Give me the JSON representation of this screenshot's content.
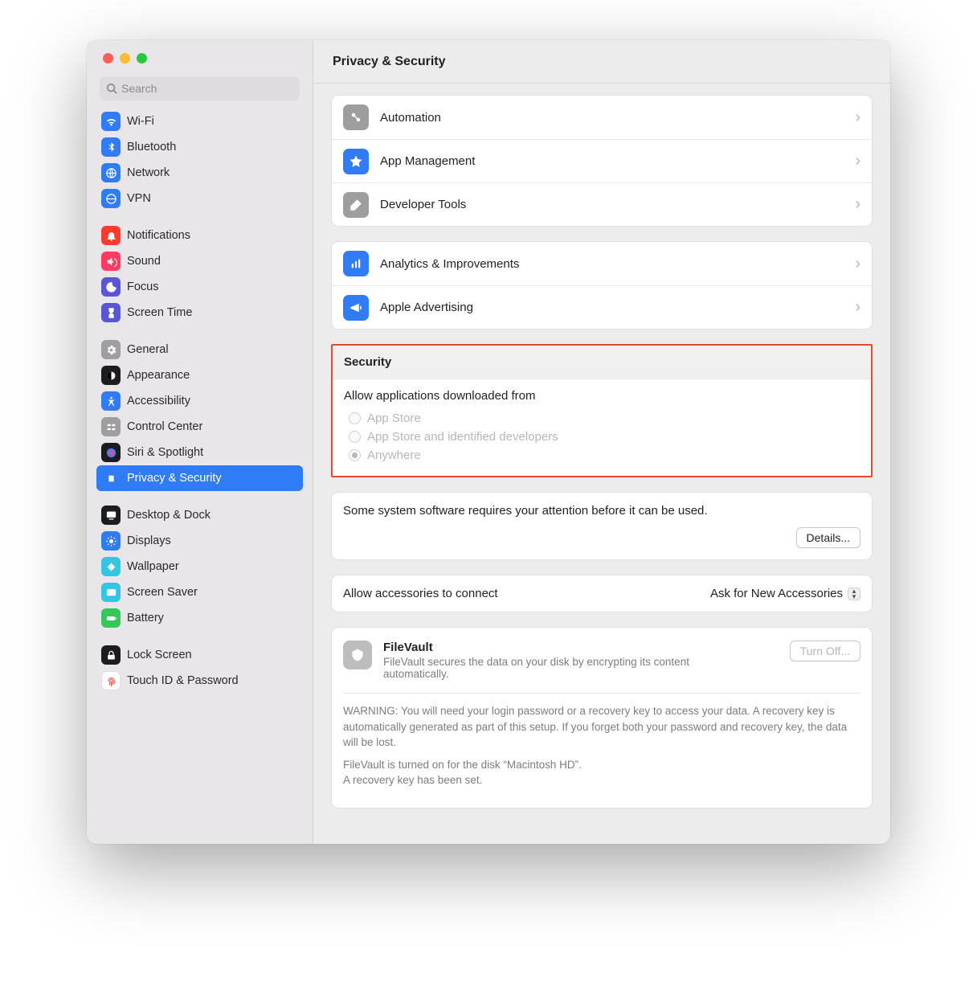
{
  "header": {
    "title": "Privacy & Security"
  },
  "search": {
    "placeholder": "Search"
  },
  "sidebar_groups": [
    [
      {
        "id": "wifi",
        "label": "Wi-Fi",
        "bg": "#2f7cf6"
      },
      {
        "id": "bluetooth",
        "label": "Bluetooth",
        "bg": "#2f7cf6"
      },
      {
        "id": "network",
        "label": "Network",
        "bg": "#2f7cf6"
      },
      {
        "id": "vpn",
        "label": "VPN",
        "bg": "#2f7cf6"
      }
    ],
    [
      {
        "id": "notifications",
        "label": "Notifications",
        "bg": "#ff3b30"
      },
      {
        "id": "sound",
        "label": "Sound",
        "bg": "#ff3b62"
      },
      {
        "id": "focus",
        "label": "Focus",
        "bg": "#5856d6"
      },
      {
        "id": "screen-time",
        "label": "Screen Time",
        "bg": "#5856d6"
      }
    ],
    [
      {
        "id": "general",
        "label": "General",
        "bg": "#9e9e9e"
      },
      {
        "id": "appearance",
        "label": "Appearance",
        "bg": "#1c1c1e"
      },
      {
        "id": "accessibility",
        "label": "Accessibility",
        "bg": "#2f7cf6"
      },
      {
        "id": "control-center",
        "label": "Control Center",
        "bg": "#9e9e9e"
      },
      {
        "id": "siri-spotlight",
        "label": "Siri & Spotlight",
        "bg": "#1c1c1e"
      },
      {
        "id": "privacy-security",
        "label": "Privacy & Security",
        "bg": "#2f7cf6",
        "active": true
      }
    ],
    [
      {
        "id": "desktop-dock",
        "label": "Desktop & Dock",
        "bg": "#1c1c1e"
      },
      {
        "id": "displays",
        "label": "Displays",
        "bg": "#2f7cf6"
      },
      {
        "id": "wallpaper",
        "label": "Wallpaper",
        "bg": "#34c5e0"
      },
      {
        "id": "screen-saver",
        "label": "Screen Saver",
        "bg": "#34c5e0"
      },
      {
        "id": "battery",
        "label": "Battery",
        "bg": "#34c759"
      }
    ],
    [
      {
        "id": "lock-screen",
        "label": "Lock Screen",
        "bg": "#1c1c1e"
      },
      {
        "id": "touch-id",
        "label": "Touch ID & Password",
        "bg": "#ffffff",
        "fg": "#ff3b30",
        "border": true
      }
    ]
  ],
  "link_panels": [
    [
      {
        "id": "automation",
        "label": "Automation",
        "bg": "#9e9e9e"
      },
      {
        "id": "app-management",
        "label": "App Management",
        "bg": "#2f7cf6"
      },
      {
        "id": "developer-tools",
        "label": "Developer Tools",
        "bg": "#9e9e9e"
      }
    ],
    [
      {
        "id": "analytics",
        "label": "Analytics & Improvements",
        "bg": "#2f7cf6"
      },
      {
        "id": "apple-advertising",
        "label": "Apple Advertising",
        "bg": "#2f7cf6"
      }
    ]
  ],
  "security": {
    "header": "Security",
    "allow_label": "Allow applications downloaded from",
    "options": [
      {
        "label": "App Store",
        "selected": false
      },
      {
        "label": "App Store and identified developers",
        "selected": false
      },
      {
        "label": "Anywhere",
        "selected": true
      }
    ]
  },
  "attention": {
    "text": "Some system software requires your attention before it can be used.",
    "button": "Details..."
  },
  "accessories": {
    "label": "Allow accessories to connect",
    "value": "Ask for New Accessories"
  },
  "filevault": {
    "title": "FileVault",
    "desc": "FileVault secures the data on your disk by encrypting its content automatically.",
    "button": "Turn Off...",
    "warn1": "WARNING: You will need your login password or a recovery key to access your data. A recovery key is automatically generated as part of this setup. If you forget both your password and recovery key, the data will be lost.",
    "warn2": "FileVault is turned on for the disk “Macintosh HD”.",
    "warn3": "A recovery key has been set."
  }
}
